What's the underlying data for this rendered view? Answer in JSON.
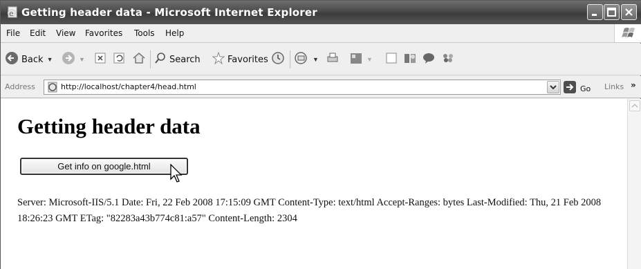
{
  "window": {
    "title": "Getting header data - Microsoft Internet Explorer"
  },
  "menu": {
    "items": [
      "File",
      "Edit",
      "View",
      "Favorites",
      "Tools",
      "Help"
    ]
  },
  "toolbar": {
    "back_label": "Back",
    "search_label": "Search",
    "favorites_label": "Favorites"
  },
  "address": {
    "label": "Address",
    "url": "http://localhost/chapter4/head.html",
    "go_label": "Go",
    "links_label": "Links",
    "links_chevron": "»"
  },
  "page": {
    "heading": "Getting header data",
    "button_label": "Get info on google.html",
    "header_text": "Server: Microsoft-IIS/5.1 Date: Fri, 22 Feb 2008 17:15:09 GMT Content-Type: text/html Accept-Ranges: bytes Last-Modified: Thu, 21 Feb 2008 18:26:23 GMT ETag: \"82283a43b774c81:a57\" Content-Length: 2304"
  }
}
